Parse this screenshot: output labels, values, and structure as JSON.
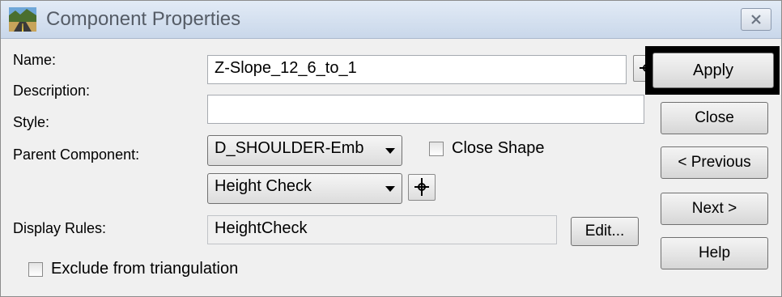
{
  "window": {
    "title": "Component Properties"
  },
  "form": {
    "name_label": "Name:",
    "name_value": "Z-Slope_12_6_to_1",
    "description_label": "Description:",
    "description_value": "",
    "style_label": "Style:",
    "style_value": "D_SHOULDER-Emb",
    "close_shape_label": "Close Shape",
    "close_shape_checked": false,
    "parent_label": "Parent Component:",
    "parent_value": "Height Check",
    "display_rules_label": "Display Rules:",
    "display_rules_value": "HeightCheck",
    "edit_label": "Edit...",
    "exclude_label": "Exclude from triangulation",
    "exclude_checked": false
  },
  "buttons": {
    "apply": "Apply",
    "close": "Close",
    "previous": "< Previous",
    "next": "Next >",
    "help": "Help"
  },
  "icons": {
    "app": "road-icon",
    "title_close": "close-x-icon",
    "pick": "crosshair-pick-icon"
  }
}
